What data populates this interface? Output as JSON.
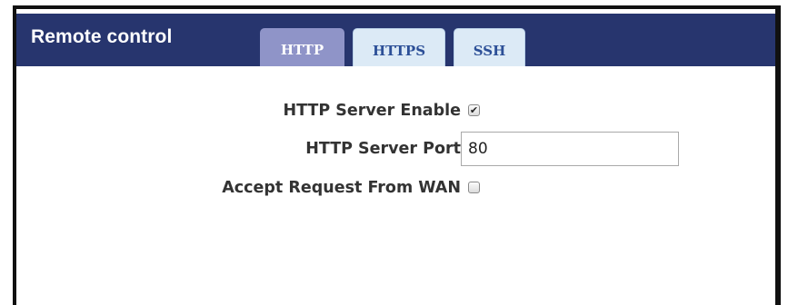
{
  "panel": {
    "title": "Remote control"
  },
  "tabs": [
    {
      "label": "HTTP",
      "active": true
    },
    {
      "label": "HTTPS",
      "active": false
    },
    {
      "label": "SSH",
      "active": false
    }
  ],
  "form": {
    "http_server_enable": {
      "label": "HTTP Server Enable",
      "checked": true,
      "check_glyph": "✔"
    },
    "http_server_port": {
      "label": "HTTP Server Port",
      "value": "80"
    },
    "accept_request_from_wan": {
      "label": "Accept Request From WAN",
      "checked": false
    }
  },
  "colors": {
    "header_bg": "#27356e",
    "active_tab_bg": "#8f94c8",
    "inactive_tab_bg": "#dceaf6",
    "inactive_tab_text": "#2c4f97"
  }
}
